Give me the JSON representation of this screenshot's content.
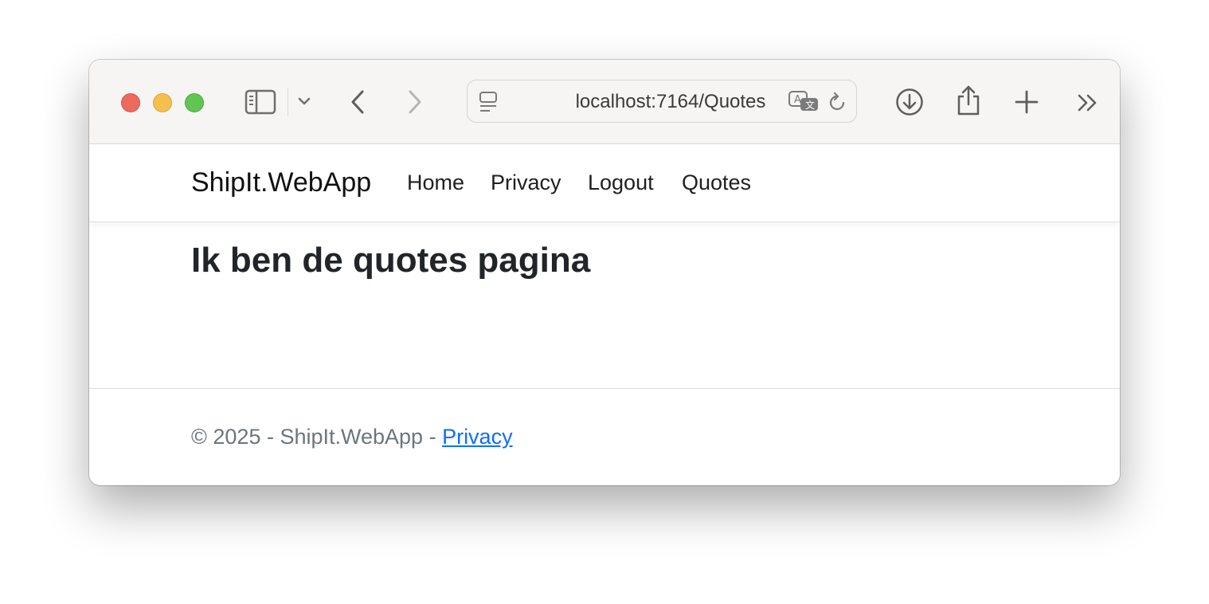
{
  "browser": {
    "url": "localhost:7164/Quotes",
    "icons": {
      "sidebar": "sidebar-icon",
      "tab_overview": "chevron-down-icon",
      "back": "chevron-left-icon",
      "forward": "chevron-right-icon",
      "reader": "reader-icon",
      "translate": "translate-icon",
      "reload": "reload-icon",
      "downloads": "download-icon",
      "share": "share-icon",
      "new_tab": "plus-icon",
      "more": "double-chevron-right-icon"
    }
  },
  "navbar": {
    "brand": "ShipIt.WebApp",
    "links": [
      "Home",
      "Privacy",
      "Logout",
      "Quotes"
    ]
  },
  "main": {
    "heading": "Ik ben de quotes pagina"
  },
  "footer": {
    "prefix": "© 2025 - ShipIt.WebApp - ",
    "link": "Privacy"
  },
  "colors": {
    "link": "#0d6efd",
    "heading": "#212529",
    "footer_text": "#6c757d"
  }
}
